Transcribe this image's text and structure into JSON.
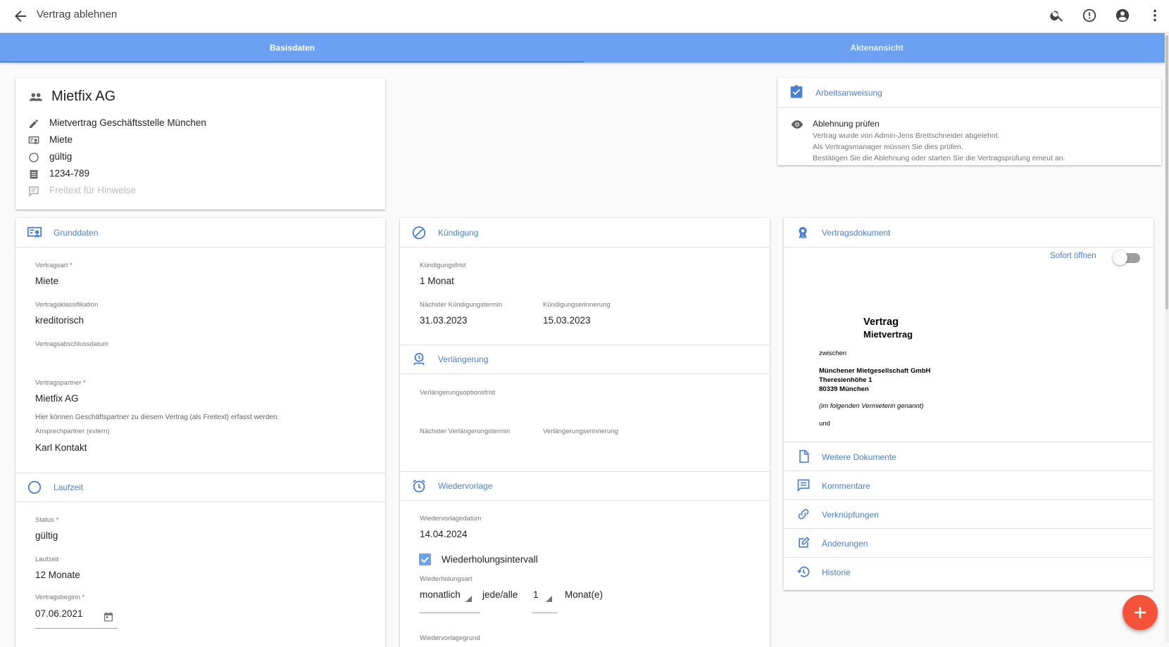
{
  "appbar": {
    "title": "Vertrag ablehnen"
  },
  "tabs": [
    {
      "label": "Basisdaten",
      "active": true
    },
    {
      "label": "Aktenansicht",
      "active": false
    }
  ],
  "summary": {
    "name": "Mietfix AG",
    "rows": [
      {
        "icon": "pencil-icon",
        "text": "Mietvertrag Geschäftsstelle München"
      },
      {
        "icon": "contract-type-icon",
        "text": "Miete"
      },
      {
        "icon": "status-icon",
        "text": "gültig"
      },
      {
        "icon": "number-icon",
        "text": "1234-789"
      },
      {
        "icon": "comment-icon",
        "text": "Freitext für Hinweise"
      }
    ]
  },
  "instruction": {
    "title": "Arbeitsanweisung",
    "task": "Ablehnung prüfen",
    "lines": [
      "Vertrag wurde von Admin-Jens Brettschneider abgelehnt.",
      "Als Vertragsmanager müssen Sie dies prüfen.",
      "Bestätigen Sie die Ablehnung oder starten Sie die Vertragsprüfung emeut an."
    ]
  },
  "grunddaten": {
    "title": "Grunddaten",
    "vertragsart_label": "Vertragsart *",
    "vertragsart": "Miete",
    "klass_label": "Vertragsklassifikation",
    "klass": "kreditorisch",
    "abschluss_label": "Vertragsabschlussdatum",
    "partner_label": "Vertragspartner *",
    "partner": "Mietfix AG",
    "partner_hint": "Hier können Geschäftspartner zu diesem Vertrag (als Freitext) erfasst werden.",
    "ansprech_label": "Ansprechpartner (extern)",
    "ansprech": "Karl Kontakt"
  },
  "laufzeit": {
    "title": "Laufzeit",
    "status_label": "Status *",
    "status": "gültig",
    "laufzeit_label": "Laufzeit",
    "laufzeit": "12 Monate",
    "beginn_label": "Vertragsbeginn *",
    "beginn": "07.06.2021"
  },
  "kuendigung": {
    "title": "Kündigung",
    "frist_label": "Kündigungsfrist",
    "frist": "1 Monat",
    "termin_label": "Nächster Kündigungstermin",
    "termin": "31.03.2023",
    "erinnerung_label": "Kündigungserinnerung",
    "erinnerung": "15.03.2023"
  },
  "verlaengerung": {
    "title": "Verlängerung",
    "optionsfrist_label": "Verlängerungsoptionsfrist",
    "termin_label": "Nächster Verlängerungstermin",
    "erinnerung_label": "Verlängerungserinnerung"
  },
  "wiedervorlage": {
    "title": "Wiedervorlage",
    "datum_label": "Wiedervorlagedatum",
    "datum": "14.04.2024",
    "intervall_label": "Wiederholungsintervall",
    "intervall_checked": true,
    "art_label": "Wiederholungsart",
    "art": "monatlich",
    "jede_alle": "jede/alle",
    "anzahl": "1",
    "einheit": "Monat(e)",
    "grund_label": "Wiedervorlagegrund"
  },
  "dokument": {
    "title": "Vertragsdokument",
    "sofort_label": "Sofort öffnen",
    "sofort_on": false,
    "preview": {
      "heading1": "Vertrag",
      "heading2": "Mietvertrag",
      "zwischen": "zwischen",
      "party1": "Münchener Mietgesellschaft GmbH",
      "party2": "Theresienhöhe 1",
      "party3": "80339 München",
      "note": "(im folgenden Vermieterin genannt)",
      "und": "und"
    },
    "links": [
      {
        "icon": "document-icon",
        "label": "Weitere Dokumente"
      },
      {
        "icon": "comment-icon",
        "label": "Kommentare"
      },
      {
        "icon": "link-icon",
        "label": "Verknüpfungen"
      },
      {
        "icon": "edit-icon",
        "label": "Änderungen"
      },
      {
        "icon": "history-icon",
        "label": "Historie"
      }
    ]
  },
  "colors": {
    "primary": "#6ca1f1",
    "accent": "#4a7fd6",
    "fab": "#f4533a"
  }
}
